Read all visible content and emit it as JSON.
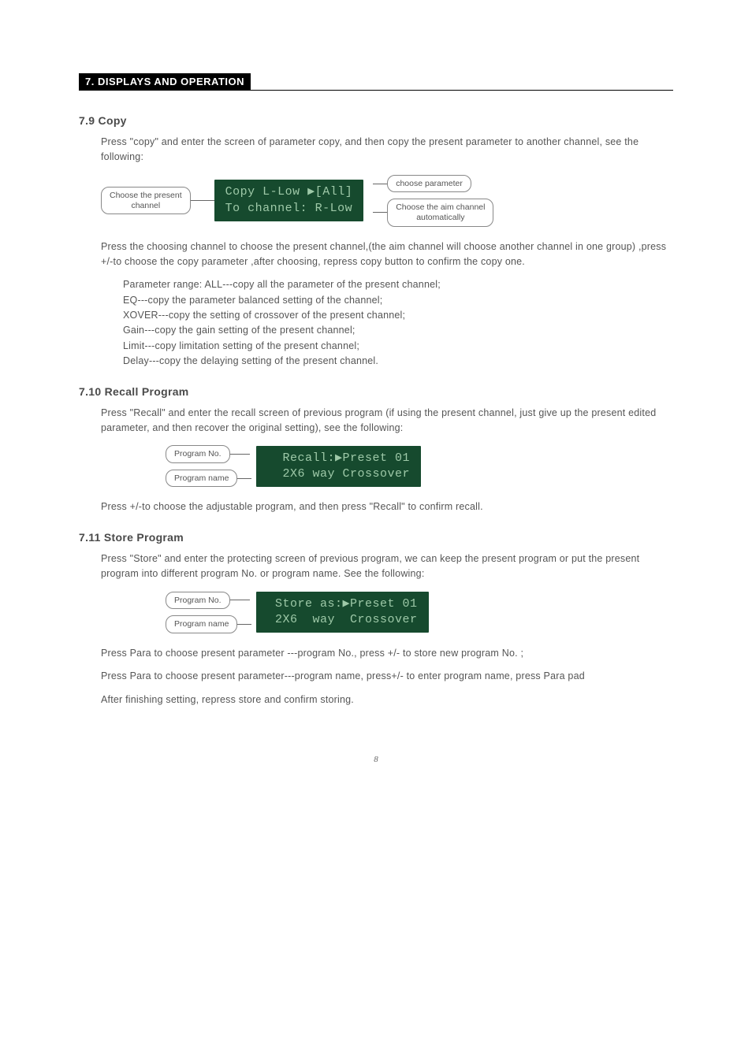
{
  "section": {
    "title": "7. DISPLAYS AND OPERATION"
  },
  "s79": {
    "heading": "7.9 Copy",
    "intro": "Press \"copy\" and enter the screen of parameter copy, and then copy the present parameter to another channel, see the following:",
    "labels": {
      "left": "Choose the present\nchannel",
      "r1": "choose parameter",
      "r2": "Choose the aim channel\nautomatically"
    },
    "lcd": {
      "l1": "Copy L-Low ▶[All]",
      "l2": "To channel: R-Low"
    },
    "p1": "Press the choosing channel to choose the present channel,(the aim channel will choose another channel in one group) ,press +/-to choose the copy parameter ,after choosing, repress copy button to confirm the copy one.",
    "b1": "Parameter range: ALL---copy all the parameter of the present channel;",
    "b2": "EQ---copy the parameter balanced setting of the channel;",
    "b3": "XOVER---copy the setting of crossover of the present channel;",
    "b4": "Gain---copy the gain setting of the present channel;",
    "b5": "Limit---copy limitation setting of the present channel;",
    "b6": "Delay---copy the delaying setting of the present channel."
  },
  "s710": {
    "heading": "7.10 Recall Program",
    "intro": "Press \"Recall\" and enter the recall screen of previous program (if using the present channel, just give up the present edited parameter, and then recover the original setting), see the following:",
    "labels": {
      "l1": "Program No.",
      "l2": "Program name"
    },
    "lcd": {
      "l1": "Recall:▶Preset 01",
      "l2": "2X6 way Crossover"
    },
    "p1": "Press +/-to choose the adjustable program, and then press \"Recall\" to confirm recall."
  },
  "s711": {
    "heading": "7.11 Store Program",
    "intro": "Press \"Store\" and enter the protecting screen of previous program, we can keep the present program or put the present program into different program No. or program name. See the following:",
    "labels": {
      "l1": "Program No.",
      "l2": "Program name"
    },
    "lcd": {
      "l1": "Store as:▶Preset 01",
      "l2": "2X6  way  Crossover"
    },
    "p1": "Press Para to choose present parameter ---program No., press +/- to store new program No. ;",
    "p2": "Press Para to choose present parameter---program name, press+/- to enter program name, press Para pad",
    "p3": "After finishing setting, repress store and confirm storing."
  },
  "pageNumber": "8"
}
